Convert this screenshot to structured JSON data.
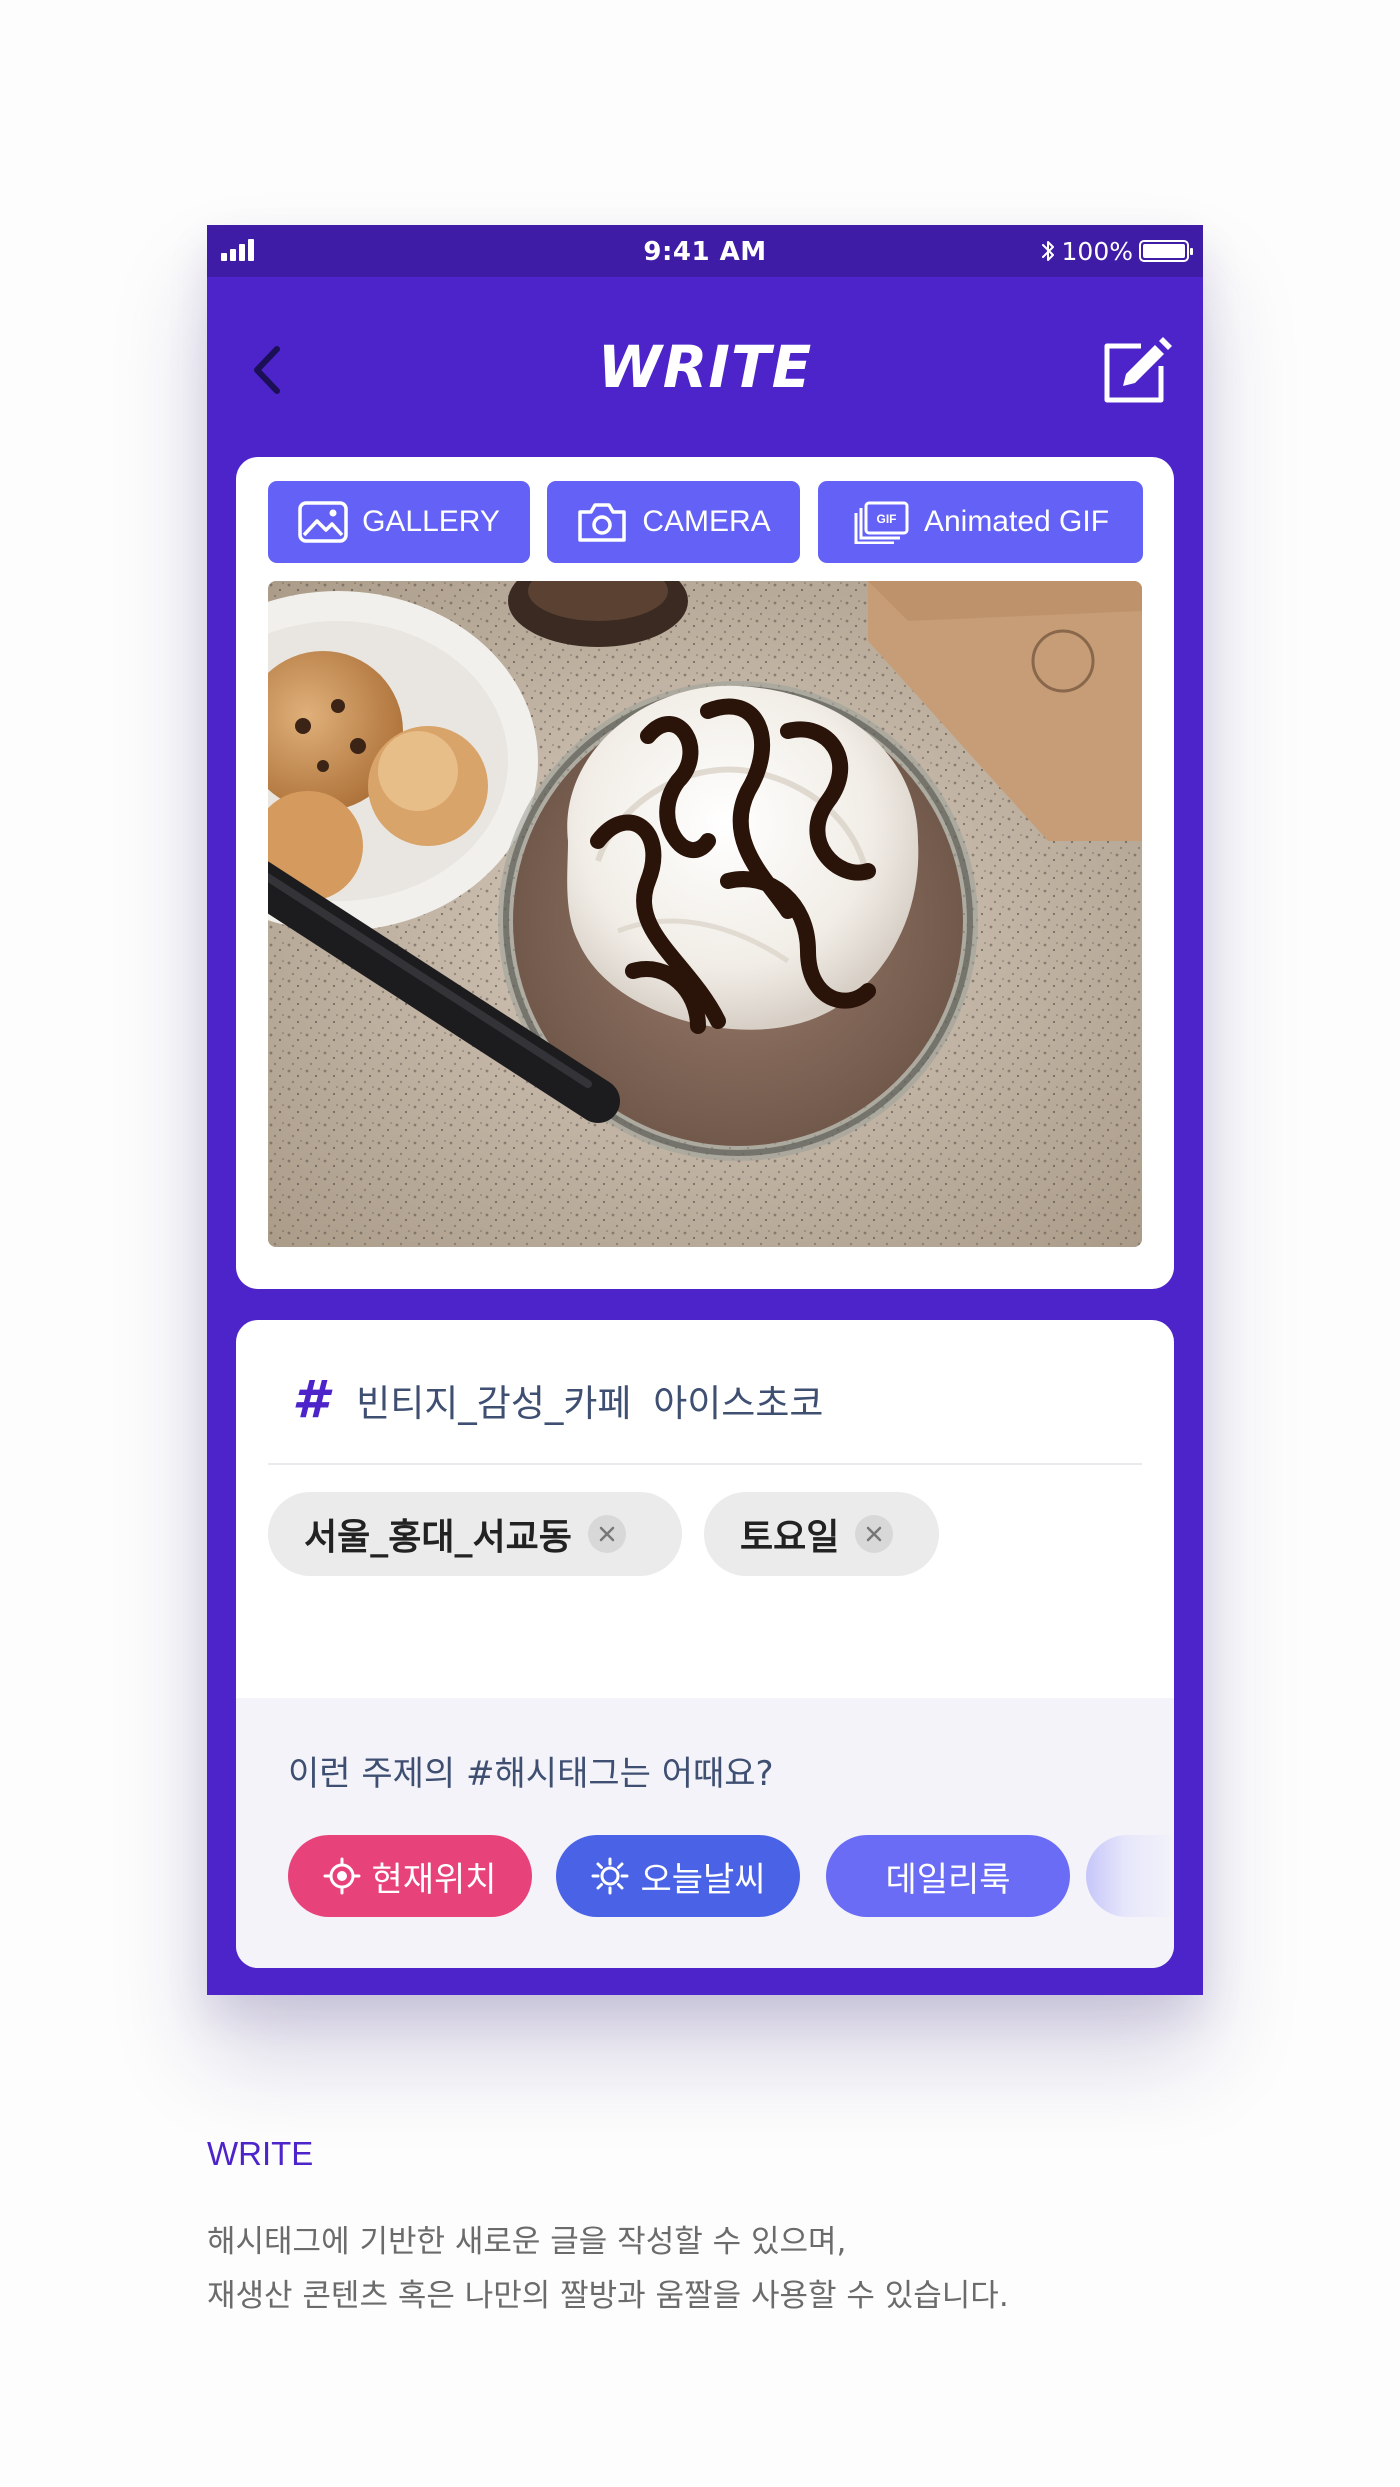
{
  "status_bar": {
    "time": "9:41 AM",
    "battery": "100%",
    "icons": [
      "signal-icon",
      "bluetooth-icon",
      "battery-icon"
    ]
  },
  "nav": {
    "title": "WRITE",
    "back_icon": "chevron-left-icon",
    "edit_icon": "edit-icon"
  },
  "media_buttons": [
    {
      "label": "GALLERY",
      "icon": "image-icon"
    },
    {
      "label": "CAMERA",
      "icon": "camera-icon"
    },
    {
      "label": "Animated GIF",
      "icon": "gif-icon"
    }
  ],
  "hashtag_input": {
    "icon": "hash-icon",
    "value": "빈티지_감성_카페  아이스초코"
  },
  "tags": [
    {
      "label": "서울_홍대_서교동"
    },
    {
      "label": "토요일"
    }
  ],
  "suggestions": {
    "title": "이런 주제의 #해시태그는 어때요?",
    "chips": [
      {
        "label": "현재위치",
        "icon": "location-target-icon",
        "color": "#e8427a"
      },
      {
        "label": "오늘날씨",
        "icon": "sun-icon",
        "color": "#4a63e6"
      },
      {
        "label": "데일리룩",
        "icon": "",
        "color": "#6b6cf6"
      }
    ]
  },
  "colors": {
    "brand": "#4d24c9",
    "status_bar": "#3f1ca6",
    "button": "#6462f6"
  },
  "caption": {
    "title": "WRITE",
    "line1": "해시태그에 기반한 새로운 글을 작성할 수 있으며,",
    "line2": "재생산 콘텐츠 혹은 나만의 짤방과 움짤을 사용할 수 있습니다."
  }
}
